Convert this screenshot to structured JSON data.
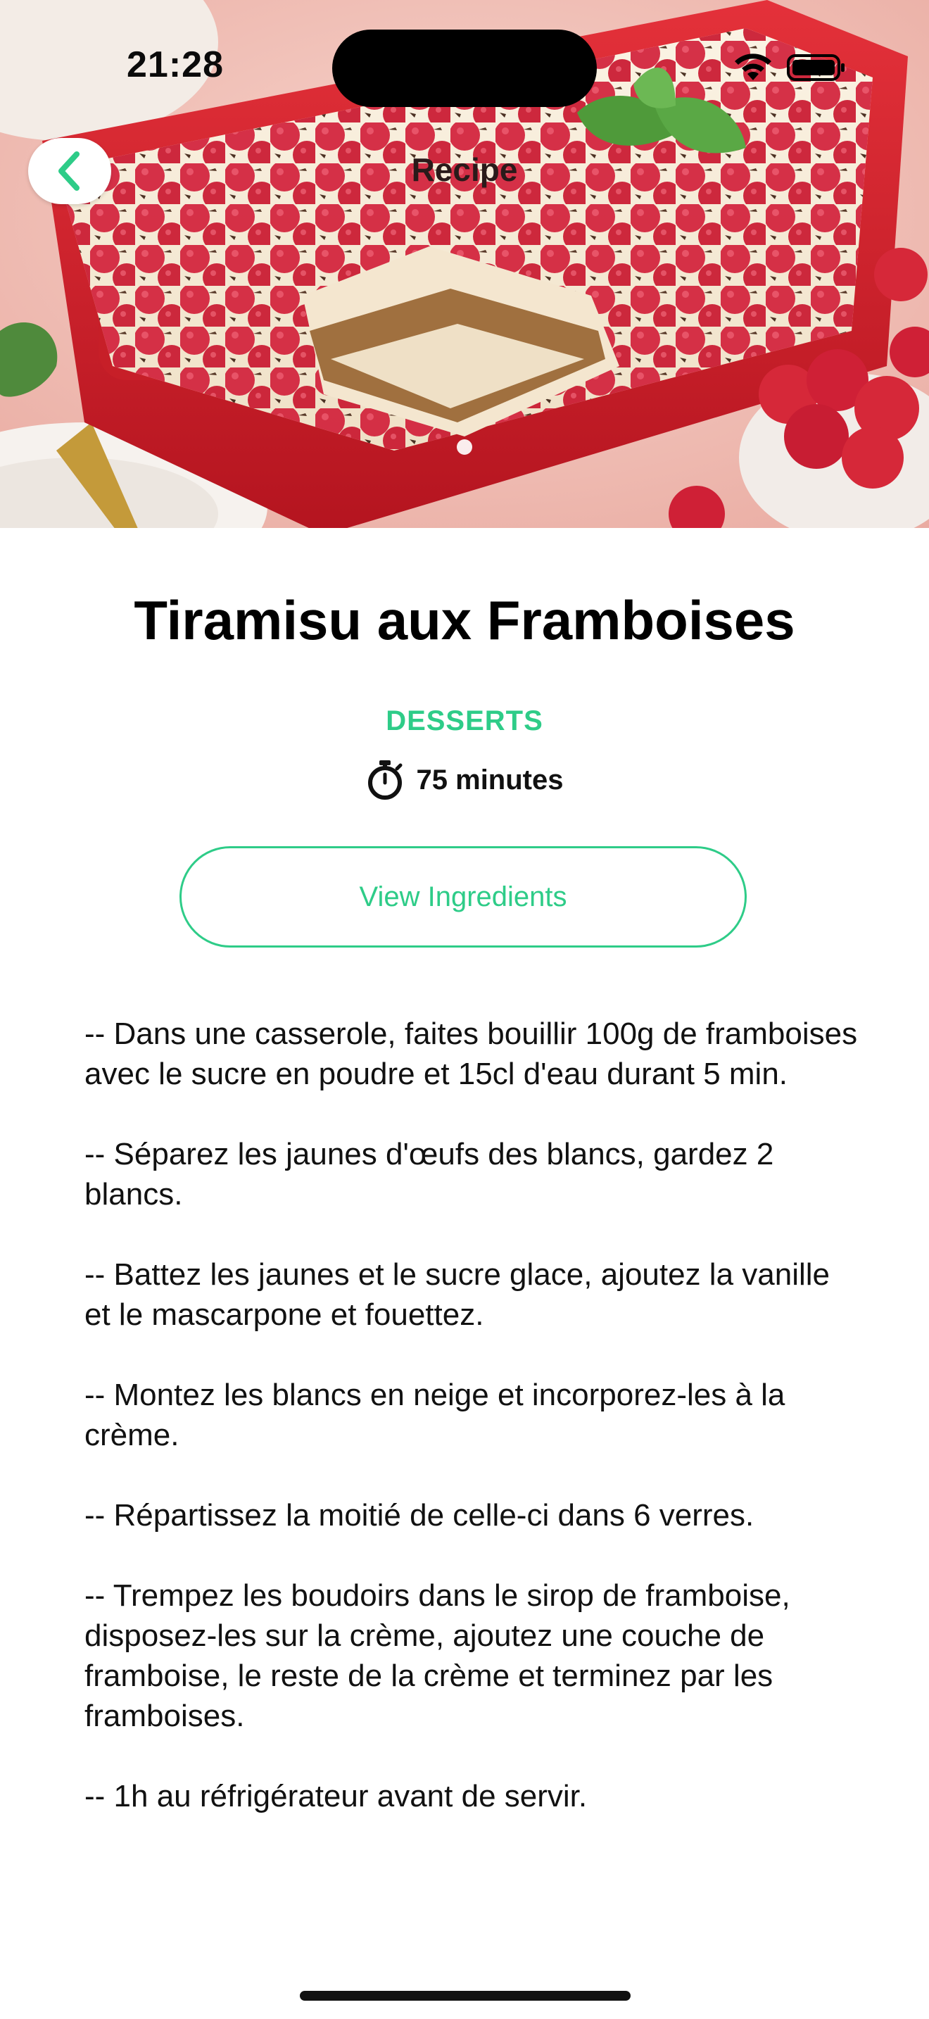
{
  "status_bar": {
    "time": "21:28"
  },
  "nav": {
    "title": "Recipe",
    "back_icon": "chevron-left-icon"
  },
  "hero": {
    "image_alt": "Tiramisu with raspberries in a red baking dish",
    "page_dots": 1,
    "active_page": 1
  },
  "recipe": {
    "title": "Tiramisu aux Framboises",
    "category": "DESSERTS",
    "duration": "75 minutes",
    "duration_icon": "stopwatch-icon",
    "ingredients_button": "View Ingredients",
    "steps": [
      "-- Dans une casserole, faites bouillir 100g de framboises avec le sucre en poudre et 15cl d'eau durant 5 min.",
      " -- Séparez les jaunes d'œufs des blancs, gardez 2 blancs.",
      " -- Battez les jaunes et le sucre glace, ajoutez la vanille et le mascarpone et fouettez.",
      " -- Montez les blancs en neige et incorporez-les à la crème.",
      " -- Répartissez la moitié de celle-ci dans 6 verres.",
      " -- Trempez les boudoirs dans le sirop de framboise, disposez-les sur la crème, ajoutez une couche de framboise, le reste de la crème et terminez par les framboises.",
      " -- 1h au réfrigérateur avant de servir."
    ]
  },
  "colors": {
    "accent": "#2ecc88",
    "dish_red": "#d3202a",
    "raspberry": "#d62839",
    "background": "#ffffff"
  }
}
